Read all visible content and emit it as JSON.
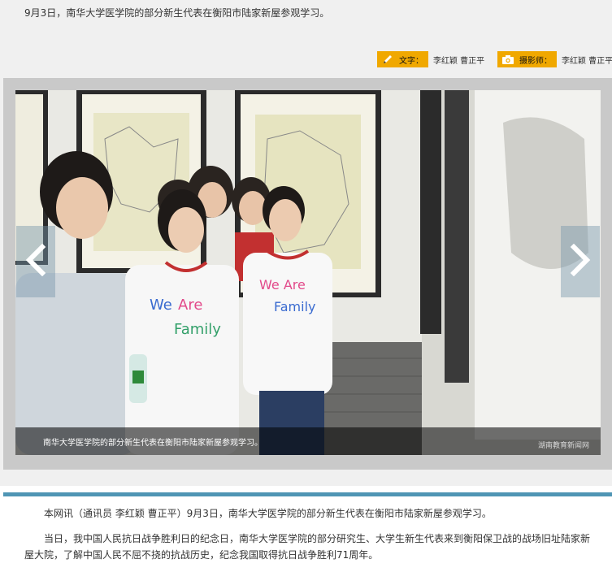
{
  "headline": "9月3日，南华大学医学院的部分新生代表在衡阳市陆家新屋参观学习。",
  "credits": {
    "text_label": "文字：",
    "text_names": "李红颖 曹正平",
    "photo_label": "摄影师：",
    "photo_names": "李红颖 曹正平"
  },
  "gallery": {
    "caption": "南华大学医学院的部分新生代表在衡阳市陆家新屋参观学习。",
    "watermark": "湖南教育新闻网",
    "shirt_text": "We Are Family"
  },
  "article": {
    "paragraphs": [
      "本网讯（通讯员 李红颖 曹正平）9月3日，南华大学医学院的部分新生代表在衡阳市陆家新屋参观学习。",
      "当日，我中国人民抗日战争胜利日的纪念日，南华大学医学院的部分研究生、大学生新生代表来到衡阳保卫战的战场旧址陆家新屋大院，了解中国人民不屈不挠的抗战历史，纪念我国取得抗日战争胜利71周年。"
    ]
  },
  "colors": {
    "badge": "#f0a800",
    "divider": "#4f95b4",
    "top_background": "#f0f0f0"
  },
  "icons": {
    "text_credit": "pencil-icon",
    "photo_credit": "camera-icon",
    "prev": "chevron-left-icon",
    "next": "chevron-right-icon"
  }
}
